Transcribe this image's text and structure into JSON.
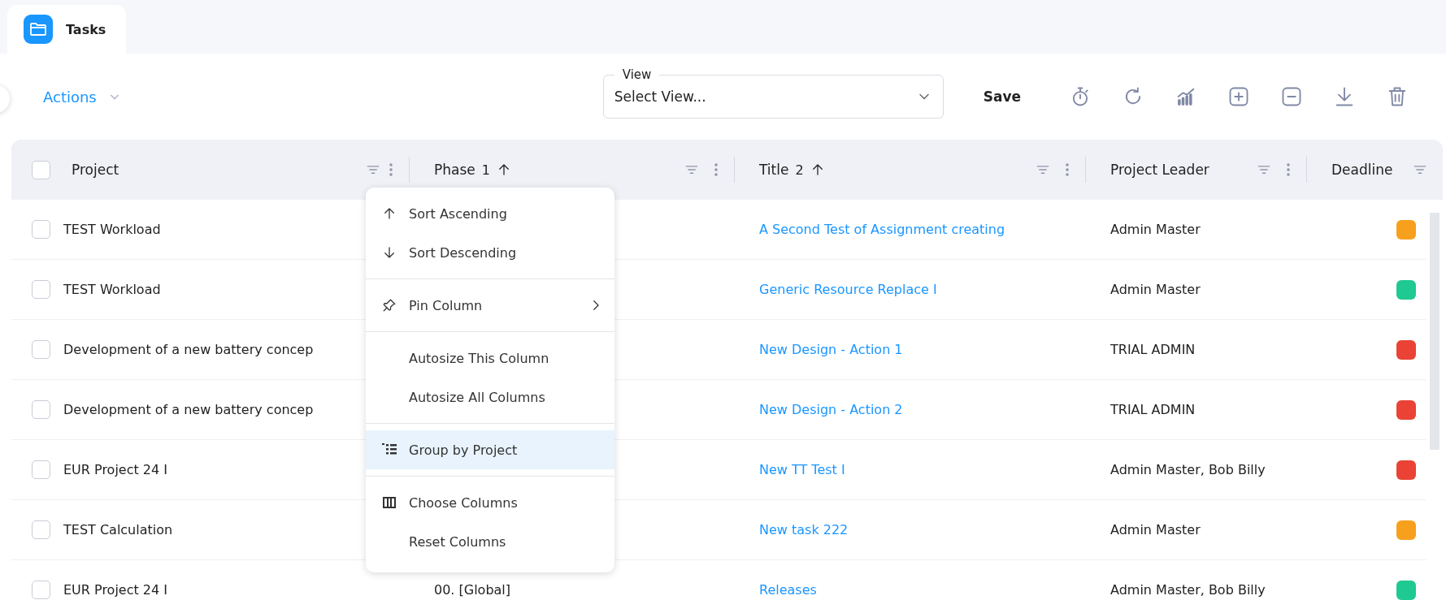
{
  "tabs": [
    {
      "label": "Tasks",
      "selected": true
    }
  ],
  "toolbar": {
    "actions_label": "Actions",
    "view": {
      "label": "View",
      "placeholder": "Select View..."
    },
    "save_label": "Save"
  },
  "table": {
    "header_checked": false,
    "columns": [
      {
        "label": "Project"
      },
      {
        "label": "Phase",
        "sort_order": "1",
        "sort_ascending": true
      },
      {
        "label": "Title",
        "sort_order": "2",
        "sort_ascending": true
      },
      {
        "label": "Project Leader"
      },
      {
        "label": "Deadline"
      }
    ],
    "rows": [
      {
        "checked": false,
        "project": "TEST Workload",
        "title": "A Second Test of Assignment creating",
        "leader": "Admin Master",
        "color": "#f7a01d"
      },
      {
        "checked": false,
        "project": "TEST Workload",
        "title": "Generic Resource Replace I",
        "leader": "Admin Master",
        "color": "#1fc992"
      },
      {
        "checked": false,
        "project": "Development of a new battery concep",
        "title": "New Design - Action 1",
        "leader": "TRIAL ADMIN",
        "color": "#ea4335"
      },
      {
        "checked": false,
        "project": "Development of a new battery concep",
        "title": "New Design - Action 2",
        "leader": "TRIAL ADMIN",
        "color": "#ea4335"
      },
      {
        "checked": false,
        "project": "EUR Project 24 I",
        "title": "New TT Test I",
        "leader": "Admin Master, Bob Billy",
        "color": "#ea4335"
      },
      {
        "checked": false,
        "project": "TEST Calculation",
        "title": "New task 222",
        "leader": "Admin Master",
        "color": "#f7a01d"
      },
      {
        "checked": false,
        "project": "EUR Project 24 I",
        "phase": "00. [Global]",
        "title": "Releases",
        "leader": "Admin Master, Bob Billy",
        "color": "#1fc992"
      }
    ]
  },
  "column_menu": {
    "groups": [
      [
        {
          "label": "Sort Ascending",
          "selected": false,
          "submenu": false
        },
        {
          "label": "Sort Descending",
          "selected": false,
          "submenu": false
        }
      ],
      [
        {
          "label": "Pin Column",
          "selected": false,
          "submenu": true
        }
      ],
      [
        {
          "label": "Autosize This Column",
          "selected": false,
          "submenu": false
        },
        {
          "label": "Autosize All Columns",
          "selected": false,
          "submenu": false
        }
      ],
      [
        {
          "label": "Group by Project",
          "selected": true,
          "submenu": false
        }
      ],
      [
        {
          "label": "Choose Columns",
          "selected": false,
          "submenu": false
        },
        {
          "label": "Reset Columns",
          "selected": false,
          "submenu": false
        }
      ]
    ]
  }
}
